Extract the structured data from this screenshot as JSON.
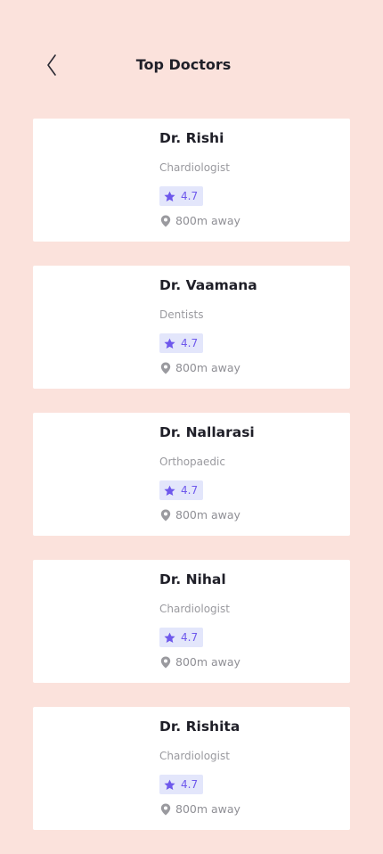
{
  "header": {
    "title": "Top Doctors",
    "back_icon": "chevron-left-icon"
  },
  "colors": {
    "background": "#fbe2dc",
    "card": "#ffffff",
    "accent": "#6e58ec",
    "rating_bg": "#e3e6fb",
    "muted_text": "#9a9a9f"
  },
  "doctors": [
    {
      "name": "Dr. Rishi",
      "specialty": "Chardiologist",
      "rating": "4.7",
      "distance": "800m away"
    },
    {
      "name": "Dr. Vaamana",
      "specialty": "Dentists",
      "rating": "4.7",
      "distance": "800m away"
    },
    {
      "name": "Dr. Nallarasi",
      "specialty": "Orthopaedic",
      "rating": "4.7",
      "distance": "800m away"
    },
    {
      "name": "Dr. Nihal",
      "specialty": "Chardiologist",
      "rating": "4.7",
      "distance": "800m away"
    },
    {
      "name": "Dr. Rishita",
      "specialty": "Chardiologist",
      "rating": "4.7",
      "distance": "800m away"
    }
  ]
}
